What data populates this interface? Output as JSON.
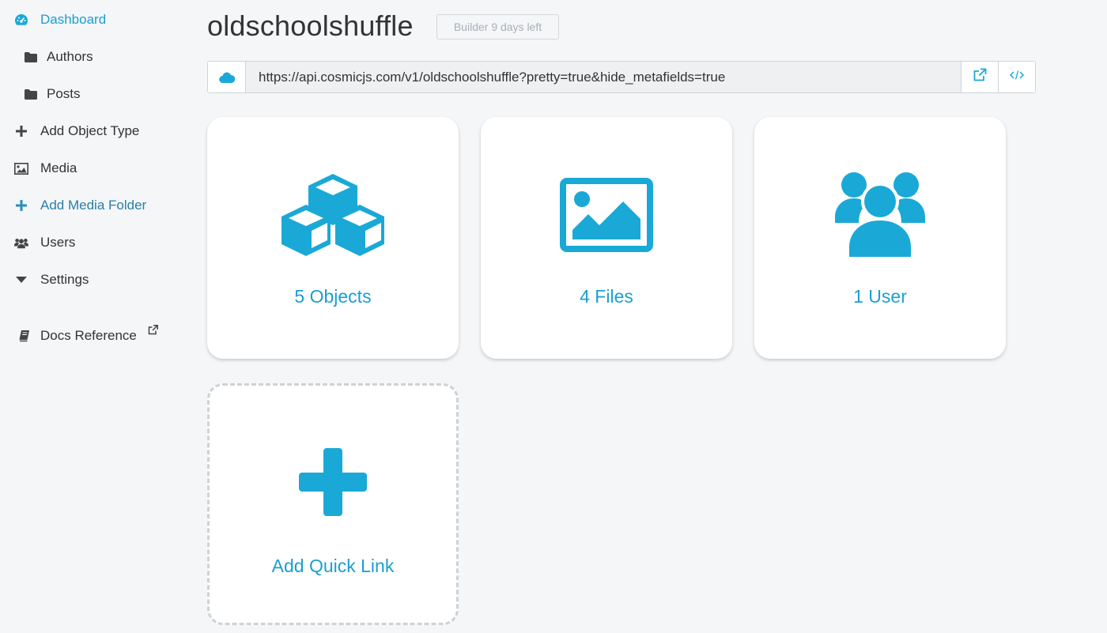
{
  "sidebar": {
    "items": [
      {
        "label": "Dashboard",
        "icon": "dashboard-gauge-icon"
      },
      {
        "label": "Authors",
        "icon": "folder-icon"
      },
      {
        "label": "Posts",
        "icon": "folder-icon"
      },
      {
        "label": "Add Object Type",
        "icon": "plus-icon"
      },
      {
        "label": "Media",
        "icon": "image-icon"
      },
      {
        "label": "Add Media Folder",
        "icon": "plus-icon"
      },
      {
        "label": "Users",
        "icon": "users-icon"
      },
      {
        "label": "Settings",
        "icon": "caret-down-icon"
      },
      {
        "label": "Docs Reference",
        "icon": "book-icon"
      }
    ]
  },
  "header": {
    "title": "oldschoolshuffle",
    "plan_badge": "Builder 9 days left"
  },
  "api": {
    "url": "https://api.cosmicjs.com/v1/oldschoolshuffle?pretty=true&hide_metafields=true"
  },
  "cards": [
    {
      "label": "5 Objects",
      "icon": "cubes-icon"
    },
    {
      "label": "4 Files",
      "icon": "picture-icon"
    },
    {
      "label": "1 User",
      "icon": "users-group-icon"
    },
    {
      "label": "Add Quick Link",
      "icon": "plus-icon"
    }
  ],
  "colors": {
    "accent": "#1aa9d6",
    "link": "#1a9fcf",
    "background": "#f4f6f8"
  }
}
